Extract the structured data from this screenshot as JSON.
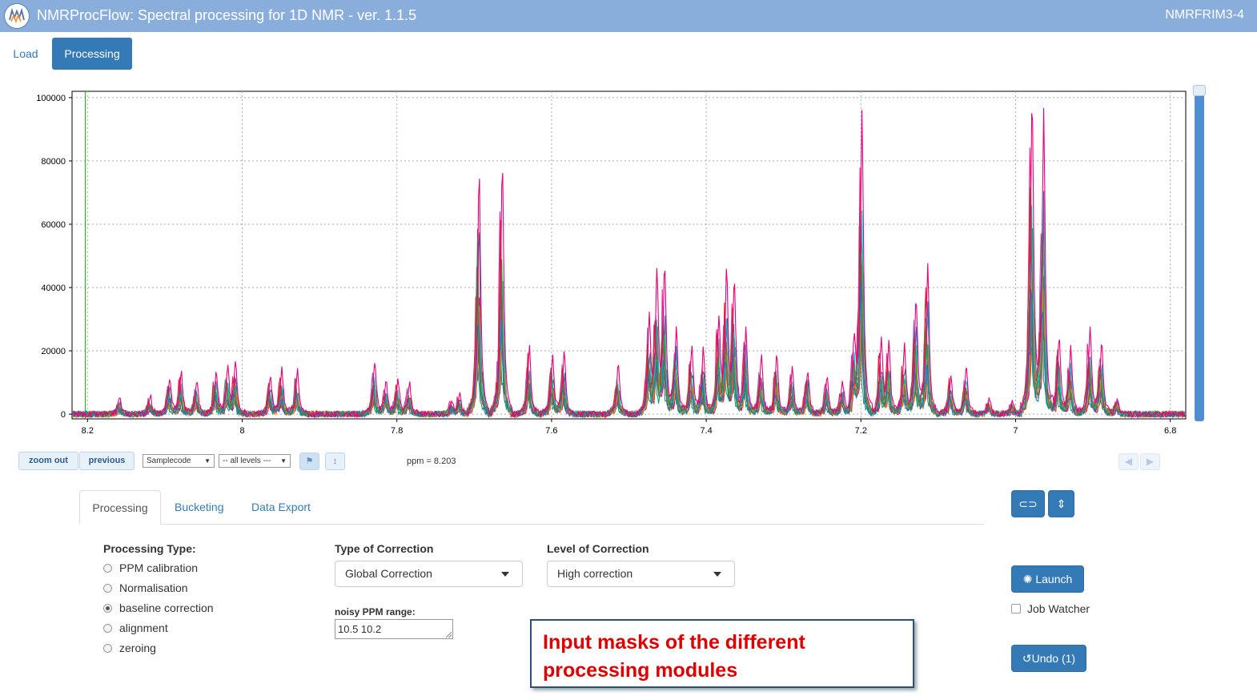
{
  "header": {
    "title": "NMRProcFlow: Spectral processing for 1D NMR - ver. 1.1.5",
    "instance": "NMRFRIM3-4"
  },
  "nav": {
    "load": "Load",
    "processing": "Processing"
  },
  "colors": {
    "header_bg": "#8aaedb",
    "accent": "#337ab7",
    "annotation_text": "#e00000",
    "spectra_palette": [
      "#e6007e",
      "#1f77b4",
      "#2ca02c",
      "#ff7f0e",
      "#d62728",
      "#17becf",
      "#9467bd",
      "#8c564b",
      "#ff1493",
      "#00a86b"
    ]
  },
  "chart_data": {
    "type": "line",
    "title": "",
    "xlabel": "",
    "ylabel": "",
    "x_reversed": true,
    "xlim": [
      8.22,
      6.78
    ],
    "ylim": [
      -1500,
      102000
    ],
    "grid": true,
    "x_ticks": [
      8.2,
      8,
      7.8,
      7.6,
      7.4,
      7.2,
      7,
      6.8
    ],
    "y_ticks": [
      0,
      20000,
      40000,
      60000,
      80000,
      100000
    ],
    "cursor_ppm": 8.203,
    "peaks": [
      {
        "ppm": 8.16,
        "height": 5500
      },
      {
        "ppm": 8.12,
        "height": 6000
      },
      {
        "ppm": 8.095,
        "height": 12000
      },
      {
        "ppm": 8.08,
        "height": 13500
      },
      {
        "ppm": 8.06,
        "height": 11000
      },
      {
        "ppm": 8.035,
        "height": 14500
      },
      {
        "ppm": 8.02,
        "height": 14500
      },
      {
        "ppm": 8.01,
        "height": 16500
      },
      {
        "ppm": 7.965,
        "height": 12000
      },
      {
        "ppm": 7.95,
        "height": 14500
      },
      {
        "ppm": 7.93,
        "height": 14000
      },
      {
        "ppm": 7.83,
        "height": 17000
      },
      {
        "ppm": 7.815,
        "height": 10500
      },
      {
        "ppm": 7.8,
        "height": 11500
      },
      {
        "ppm": 7.785,
        "height": 10000
      },
      {
        "ppm": 7.73,
        "height": 4000
      },
      {
        "ppm": 7.72,
        "height": 6000
      },
      {
        "ppm": 7.695,
        "height": 77000
      },
      {
        "ppm": 7.665,
        "height": 80000
      },
      {
        "ppm": 7.63,
        "height": 22000
      },
      {
        "ppm": 7.6,
        "height": 19000
      },
      {
        "ppm": 7.585,
        "height": 19500
      },
      {
        "ppm": 7.515,
        "height": 16000
      },
      {
        "ppm": 7.475,
        "height": 30000
      },
      {
        "ppm": 7.465,
        "height": 43000
      },
      {
        "ppm": 7.455,
        "height": 45500
      },
      {
        "ppm": 7.44,
        "height": 28000
      },
      {
        "ppm": 7.42,
        "height": 22000
      },
      {
        "ppm": 7.405,
        "height": 21000
      },
      {
        "ppm": 7.385,
        "height": 30000
      },
      {
        "ppm": 7.375,
        "height": 43000
      },
      {
        "ppm": 7.365,
        "height": 42000
      },
      {
        "ppm": 7.35,
        "height": 27000
      },
      {
        "ppm": 7.33,
        "height": 19000
      },
      {
        "ppm": 7.31,
        "height": 19500
      },
      {
        "ppm": 7.29,
        "height": 15000
      },
      {
        "ppm": 7.27,
        "height": 14000
      },
      {
        "ppm": 7.245,
        "height": 12000
      },
      {
        "ppm": 7.225,
        "height": 10500
      },
      {
        "ppm": 7.21,
        "height": 22000
      },
      {
        "ppm": 7.2,
        "height": 96000
      },
      {
        "ppm": 7.175,
        "height": 23000
      },
      {
        "ppm": 7.165,
        "height": 22000
      },
      {
        "ppm": 7.145,
        "height": 22000
      },
      {
        "ppm": 7.13,
        "height": 38000
      },
      {
        "ppm": 7.115,
        "height": 48000
      },
      {
        "ppm": 7.085,
        "height": 12500
      },
      {
        "ppm": 7.065,
        "height": 15000
      },
      {
        "ppm": 7.035,
        "height": 5000
      },
      {
        "ppm": 7.005,
        "height": 4000
      },
      {
        "ppm": 6.98,
        "height": 101000
      },
      {
        "ppm": 6.965,
        "height": 97000
      },
      {
        "ppm": 6.945,
        "height": 24500
      },
      {
        "ppm": 6.93,
        "height": 22000
      },
      {
        "ppm": 6.905,
        "height": 27000
      },
      {
        "ppm": 6.89,
        "height": 24000
      },
      {
        "ppm": 6.87,
        "height": 5000
      }
    ]
  },
  "toolbar": {
    "zoom_out": "zoom out",
    "previous": "previous",
    "samplecode": "Samplecode",
    "levels": "-- all levels ---",
    "ppm_readout": "ppm = 8.203"
  },
  "tabs": [
    "Processing",
    "Bucketing",
    "Data Export"
  ],
  "form": {
    "processing_type_label": "Processing Type:",
    "processing_types": [
      "PPM calibration",
      "Normalisation",
      "baseline correction",
      "alignment",
      "zeroing"
    ],
    "selected_type": "baseline correction",
    "type_of_correction_label": "Type of Correction",
    "type_of_correction_value": "Global Correction",
    "level_of_correction_label": "Level of Correction",
    "level_of_correction_value": "High correction",
    "noisy_range_label": "noisy PPM range:",
    "noisy_range_value": "10.5 10.2"
  },
  "actions": {
    "launch": "Launch",
    "job_watcher": "Job Watcher",
    "undo": "Undo (1)"
  },
  "annotation": "Input masks of the different processing modules"
}
